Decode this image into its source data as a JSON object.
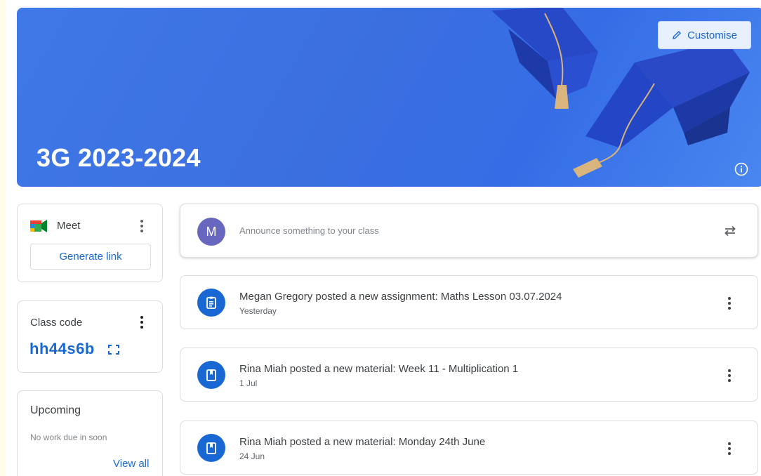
{
  "banner": {
    "title": "3G 2023-2024",
    "customise_label": "Customise",
    "bg_color": "#3b6fe0"
  },
  "meet": {
    "label": "Meet",
    "generate_link_label": "Generate link"
  },
  "class_code": {
    "label": "Class code",
    "value": "hh44s6b"
  },
  "upcoming": {
    "title": "Upcoming",
    "empty_text": "No work due in soon",
    "view_all_label": "View all"
  },
  "announce": {
    "avatar_initial": "M",
    "placeholder": "Announce something to your class"
  },
  "posts": [
    {
      "icon": "assignment-icon",
      "title": "Megan Gregory posted a new assignment: Maths Lesson 03.07.2024",
      "date": "Yesterday"
    },
    {
      "icon": "material-icon",
      "title": "Rina Miah posted a new material: Week 11 - Multiplication 1",
      "date": "1 Jul"
    },
    {
      "icon": "material-icon",
      "title": "Rina Miah posted a new material: Monday 24th June",
      "date": "24 Jun"
    }
  ],
  "colors": {
    "accent": "#1967d2",
    "avatar": "#6767c0"
  }
}
